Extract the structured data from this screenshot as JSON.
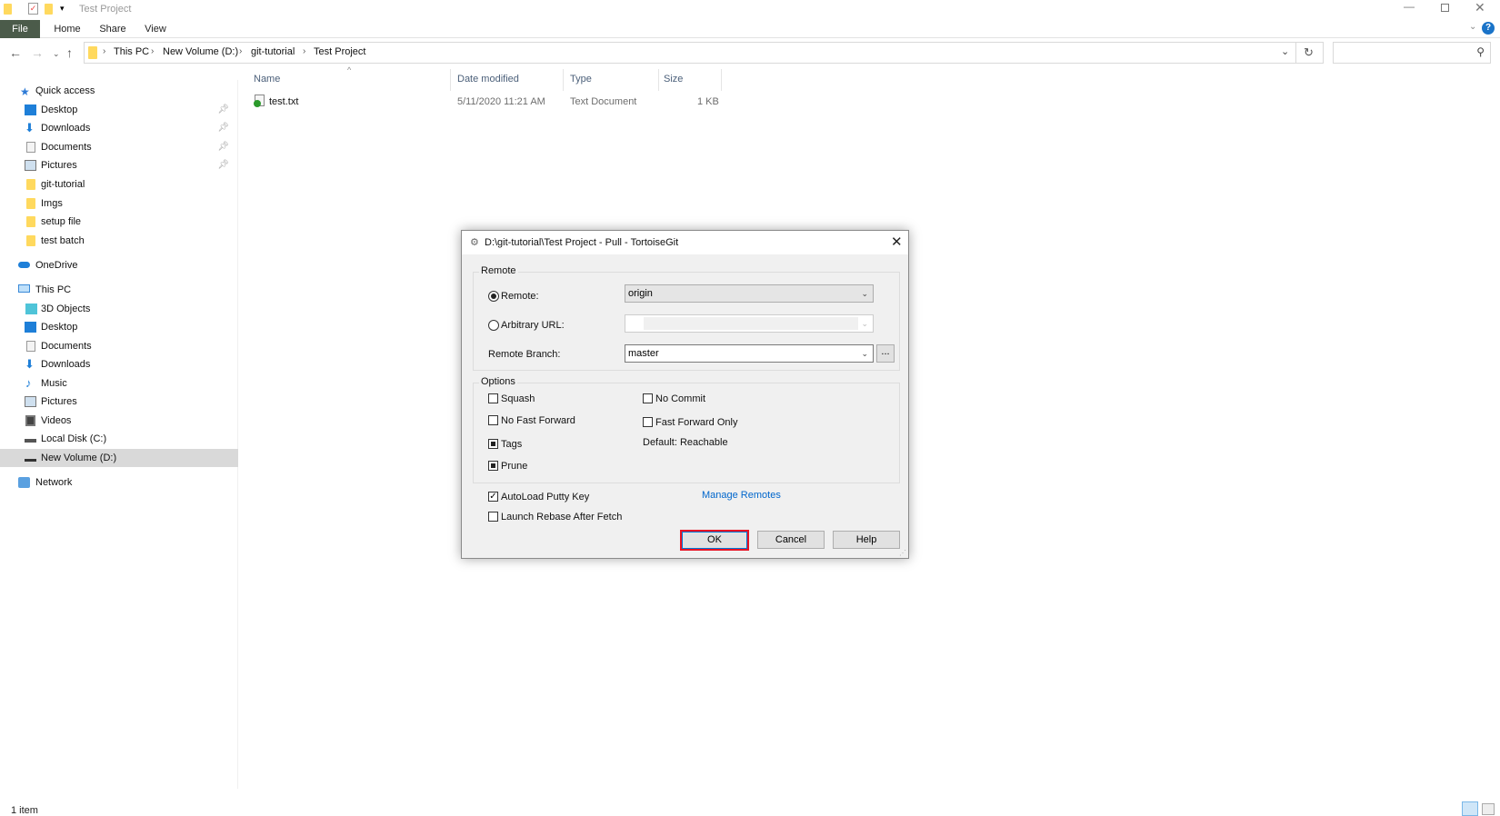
{
  "window": {
    "title": "Test Project"
  },
  "ribbon": {
    "tabs": [
      "File",
      "Home",
      "Share",
      "View"
    ]
  },
  "address": {
    "crumbs": [
      "This PC",
      "New Volume (D:)",
      "git-tutorial",
      "Test Project"
    ],
    "search_placeholder": ""
  },
  "sidebar": {
    "quick_access": "Quick access",
    "quick_items": [
      {
        "label": "Desktop",
        "pinned": true
      },
      {
        "label": "Downloads",
        "pinned": true
      },
      {
        "label": "Documents",
        "pinned": true
      },
      {
        "label": "Pictures",
        "pinned": true
      },
      {
        "label": "git-tutorial"
      },
      {
        "label": "Imgs"
      },
      {
        "label": "setup file"
      },
      {
        "label": "test batch"
      }
    ],
    "onedrive": "OneDrive",
    "this_pc": "This PC",
    "pc_items": [
      "3D Objects",
      "Desktop",
      "Documents",
      "Downloads",
      "Music",
      "Pictures",
      "Videos",
      "Local Disk (C:)",
      "New Volume (D:)"
    ],
    "network": "Network",
    "selected": "New Volume (D:)"
  },
  "files": {
    "columns": [
      "Name",
      "Date modified",
      "Type",
      "Size"
    ],
    "rows": [
      {
        "name": "test.txt",
        "date": "5/11/2020 11:21 AM",
        "type": "Text Document",
        "size": "1 KB"
      }
    ]
  },
  "status": {
    "count": "1 item"
  },
  "dialog": {
    "title": "D:\\git-tutorial\\Test Project - Pull - TortoiseGit",
    "remote_group": "Remote",
    "remote_label": "Remote:",
    "remote_value": "origin",
    "arbitrary_label": "Arbitrary URL:",
    "arbitrary_value": "",
    "branch_label": "Remote Branch:",
    "branch_value": "master",
    "browse_label": "...",
    "options_group": "Options",
    "squash": "Squash",
    "no_commit": "No Commit",
    "no_ff": "No Fast Forward",
    "ff_only": "Fast Forward Only",
    "tags": "Tags",
    "default_reachable": "Default: Reachable",
    "prune": "Prune",
    "autoload": "AutoLoad Putty Key",
    "manage_remotes": "Manage Remotes",
    "launch_rebase": "Launch Rebase After Fetch",
    "ok": "OK",
    "cancel": "Cancel",
    "help": "Help",
    "accent": "#0066cc",
    "highlight": "#e81123"
  }
}
